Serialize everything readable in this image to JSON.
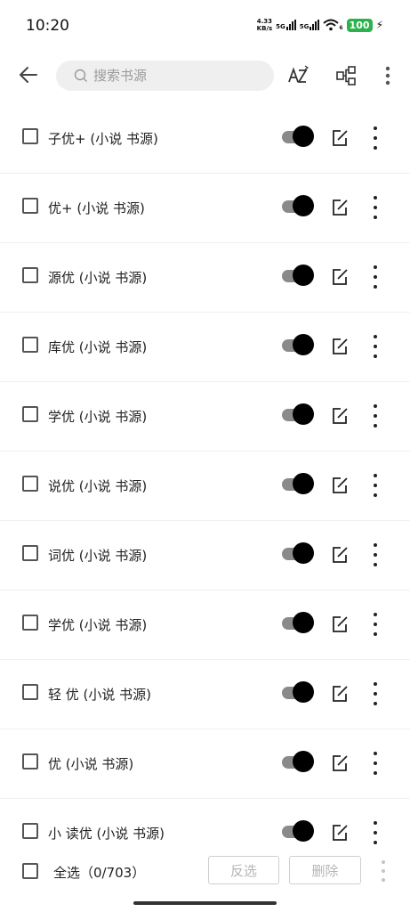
{
  "status_bar": {
    "time": "10:20",
    "net_speed_value": "4.33",
    "net_speed_unit": "KB/s",
    "signal_1": "5G",
    "signal_2": "5G",
    "wifi_badge": "6",
    "battery": "100"
  },
  "toolbar": {
    "search_placeholder": "搜索书源"
  },
  "sources": [
    {
      "name": "子优+ (小说 书源)"
    },
    {
      "name": "优+ (小说 书源)"
    },
    {
      "name": "源优 (小说 书源)"
    },
    {
      "name": "库优 (小说 书源)"
    },
    {
      "name": "学优 (小说 书源)"
    },
    {
      "name": "说优 (小说 书源)"
    },
    {
      "name": "词优 (小说 书源)"
    },
    {
      "name": "学优 (小说 书源)"
    },
    {
      "name": "轻 优 (小说 书源)"
    },
    {
      "name": "优 (小说 书源)"
    },
    {
      "name": "小 读优 (小说 书源)"
    }
  ],
  "bottom_bar": {
    "select_all": "全选（0/703）",
    "invert_label": "反选",
    "delete_label": "删除"
  },
  "colors": {
    "battery": "#2bb24c",
    "toggle_thumb": "#000000",
    "toggle_track": "#8a8a8a"
  }
}
